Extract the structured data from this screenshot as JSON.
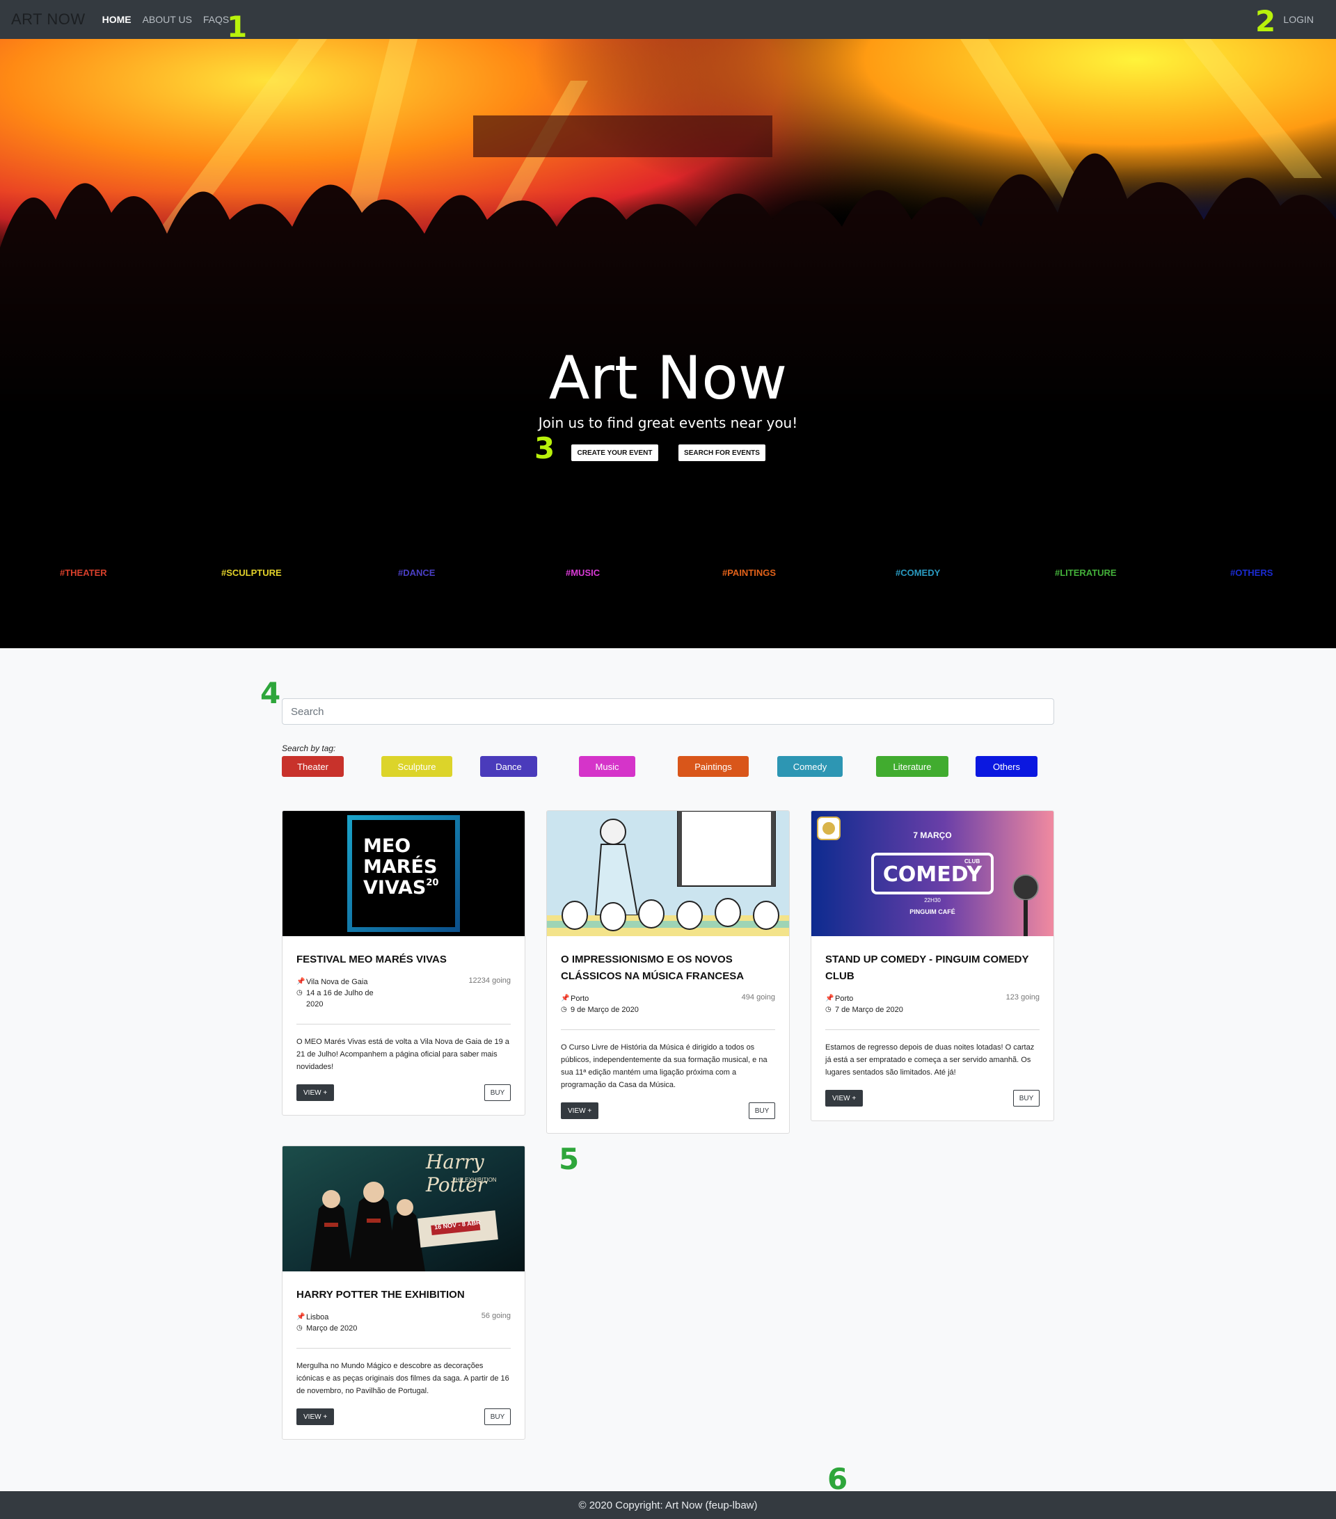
{
  "navbar": {
    "brand": "ART NOW",
    "links": [
      "HOME",
      "ABOUT US",
      "FAQS"
    ],
    "login": "LOGIN"
  },
  "markers": [
    "1",
    "2",
    "3",
    "4",
    "5",
    "6"
  ],
  "hero": {
    "title": "Art Now",
    "subtitle": "Join us to find great events near you!",
    "create_button": "CREATE YOUR EVENT",
    "search_button": "SEARCH FOR EVENTS",
    "tags": [
      {
        "label": "#THEATER",
        "color": "#d9402b"
      },
      {
        "label": "#SCULPTURE",
        "color": "#e3d22a"
      },
      {
        "label": "#DANCE",
        "color": "#4a3fc4"
      },
      {
        "label": "#MUSIC",
        "color": "#d93bd6"
      },
      {
        "label": "#PAINTINGS",
        "color": "#e2621a"
      },
      {
        "label": "#COMEDY",
        "color": "#2a9ac0"
      },
      {
        "label": "#LITERATURE",
        "color": "#43b03a"
      },
      {
        "label": "#OTHERS",
        "color": "#1b2bd1"
      }
    ]
  },
  "search": {
    "placeholder": "Search",
    "by_tag_label": "Search by tag:",
    "tags": [
      {
        "label": "Theater",
        "color": "#c8322b"
      },
      {
        "label": "Sculpture",
        "color": "#dcd42a"
      },
      {
        "label": "Dance",
        "color": "#4a3bbb"
      },
      {
        "label": "Music",
        "color": "#d534c9"
      },
      {
        "label": "Paintings",
        "color": "#d9561a"
      },
      {
        "label": "Comedy",
        "color": "#2d96b3"
      },
      {
        "label": "Literature",
        "color": "#41ac2f"
      },
      {
        "label": "Others",
        "color": "#0b18e0"
      }
    ]
  },
  "events": [
    {
      "title": "FESTIVAL MEO MARÉS VIVAS",
      "location": "Vila Nova de Gaia",
      "date": "14 a 16 de Julho de 2020",
      "going": "12234 going",
      "description": "O MEO Marés Vivas está de volta a Vila Nova de Gaia de 19 a 21 de Julho! Acompanhem a página oficial para saber mais novidades!",
      "image_text": [
        "MEO",
        "MARÉS",
        "VIVAS",
        "20"
      ],
      "view": "VIEW +",
      "buy": "BUY"
    },
    {
      "title": "O IMPRESSIONISMO E OS NOVOS CLÁSSICOS NA MÚSICA FRANCESA",
      "location": "Porto",
      "date": "9 de Março de 2020",
      "going": "494 going",
      "description": "O Curso Livre de História da Música é dirigido a todos os públicos, independentemente da sua formação musical, e na sua 11ª edição mantém uma ligação próxima com a programação da Casa da Música.",
      "view": "VIEW +",
      "buy": "BUY"
    },
    {
      "title": "STAND UP COMEDY - PINGUIM COMEDY CLUB",
      "location": "Porto",
      "date": "7 de Março de 2020",
      "going": "123 going",
      "description": "Estamos de regresso depois de duas noites lotadas! O cartaz já está a ser empratado e começa a ser servido amanhã. Os lugares sentados são limitados. Até já!",
      "image_text": [
        "7 MARÇO",
        "CLUB",
        "COMEDY",
        "22H30",
        "PINGUIM CAFÉ"
      ],
      "view": "VIEW +",
      "buy": "BUY"
    },
    {
      "title": "HARRY POTTER THE EXHIBITION",
      "location": "Lisboa",
      "date": "Março de 2020",
      "going": "56 going",
      "description": "Mergulha no Mundo Mágico e descobre as decorações icónicas e as peças originais dos filmes da saga. A partir de 16 de novembro, no Pavilhão de Portugal.",
      "image_text": [
        "Harry Potter",
        "THE EXHIBITION",
        "16 NOV - 8 ABR"
      ],
      "view": "VIEW +",
      "buy": "BUY"
    }
  ],
  "footer": "© 2020 Copyright: Art Now (feup-lbaw)"
}
